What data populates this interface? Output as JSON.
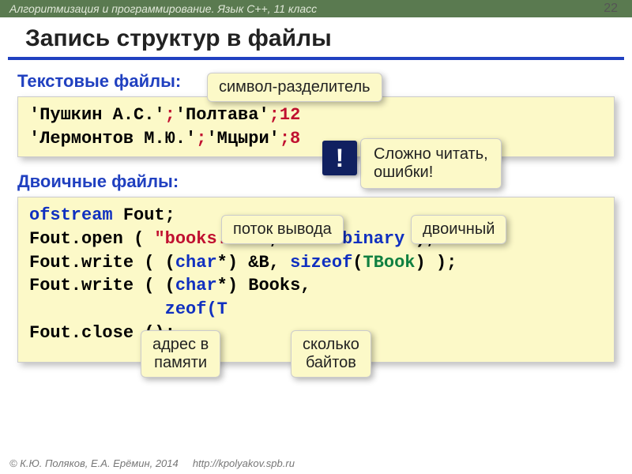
{
  "topbar": "Алгоритмизация и программирование. Язык C++, 11 класс",
  "page_num": "22",
  "title": "Запись структур в файлы",
  "sub1": "Текстовые файлы:",
  "sub2": "Двоичные файлы:",
  "code1": {
    "l1a": "'Пушкин А.С.'",
    "l1b": ";",
    "l1c": "'Полтава'",
    "l1d": ";12",
    "l2a": "'Лермонтов М.Ю.'",
    "l2b": ";",
    "l2c": "'Мцыри'",
    "l2d": ";8"
  },
  "code2": {
    "l1a": "ofstream",
    "l1b": " Fout;",
    "l2a": "Fout.open ( ",
    "l2b": "\"books.dat\"",
    "l2c": ", ",
    "l2d": "ios::binary",
    "l2e": " );",
    "l3a": "Fout.write ( (",
    "l3b": "char",
    "l3c": "*) &B, ",
    "l3d": "sizeof",
    "l3e": "(",
    "l3f": "TBook",
    "l3g": ") );",
    "l4a": "Fout.write ( (",
    "l4b": "char",
    "l4c": "*) Books,",
    "l5a": "адрес в",
    "l5b": "zeof(T",
    "l5c": "сколько",
    "l6a": "Fout.close ();"
  },
  "call_sep": "символ-разделитель",
  "call_err": "Сложно читать,\nошибки!",
  "call_stream": "поток вывода",
  "call_binary": "двоичный",
  "call_addr1": "адрес в",
  "call_addr2": "памяти",
  "call_bytes1": "сколько",
  "call_bytes2": "байтов",
  "bang": "!",
  "footer_author": "© К.Ю. Поляков, Е.А. Ерёмин, 2014",
  "footer_link": "http://kpolyakov.spb.ru"
}
